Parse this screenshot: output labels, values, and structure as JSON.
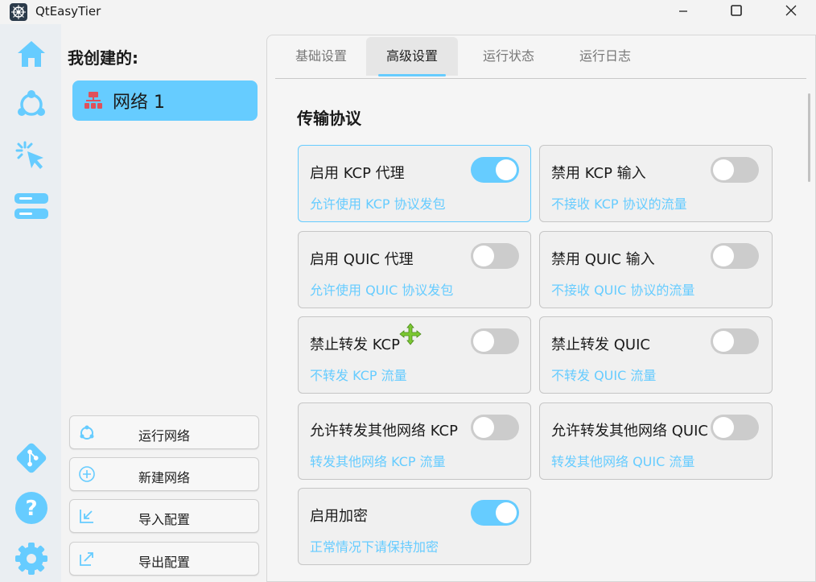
{
  "window": {
    "title": "QtEasyTier",
    "controls": [
      "minimize-icon",
      "maximize-icon",
      "close-icon"
    ]
  },
  "rail": {
    "icons": [
      "home-icon",
      "network-share-icon",
      "click-icon",
      "server-icon",
      "git-icon",
      "help-icon",
      "settings-icon"
    ]
  },
  "network_panel": {
    "heading": "我创建的:",
    "items": [
      {
        "label": "网络 1",
        "icon": "network-tree-icon"
      }
    ],
    "actions": [
      {
        "label": "运行网络",
        "icon": "run-network-icon"
      },
      {
        "label": "新建网络",
        "icon": "add-circle-icon"
      },
      {
        "label": "导入配置",
        "icon": "import-icon"
      },
      {
        "label": "导出配置",
        "icon": "export-icon"
      }
    ]
  },
  "tabs": [
    {
      "label": "基础设置",
      "active": false
    },
    {
      "label": "高级设置",
      "active": true
    },
    {
      "label": "运行状态",
      "active": false
    },
    {
      "label": "运行日志",
      "active": false
    }
  ],
  "section": {
    "title": "传输协议",
    "cards": [
      {
        "title": "启用 KCP 代理",
        "desc": "允许使用 KCP 协议发包",
        "on": true
      },
      {
        "title": "禁用 KCP 输入",
        "desc": "不接收 KCP 协议的流量",
        "on": false
      },
      {
        "title": "启用 QUIC 代理",
        "desc": "允许使用 QUIC 协议发包",
        "on": false
      },
      {
        "title": "禁用 QUIC 输入",
        "desc": "不接收 QUIC 协议的流量",
        "on": false
      },
      {
        "title": "禁止转发 KCP",
        "desc": "不转发 KCP 流量",
        "on": false
      },
      {
        "title": "禁止转发 QUIC",
        "desc": "不转发 QUIC 流量",
        "on": false
      },
      {
        "title": "允许转发其他网络 KCP",
        "desc": "转发其他网络 KCP 流量",
        "on": false
      },
      {
        "title": "允许转发其他网络 QUIC",
        "desc": "转发其他网络 QUIC 流量",
        "on": false
      },
      {
        "title": "启用加密",
        "desc": "正常情况下请保持加密",
        "on": true
      }
    ]
  },
  "colors": {
    "accent": "#66ccff",
    "toggle_off": "#cccccc",
    "network_icon": "#e0505a",
    "cursor": "#7cc832"
  }
}
